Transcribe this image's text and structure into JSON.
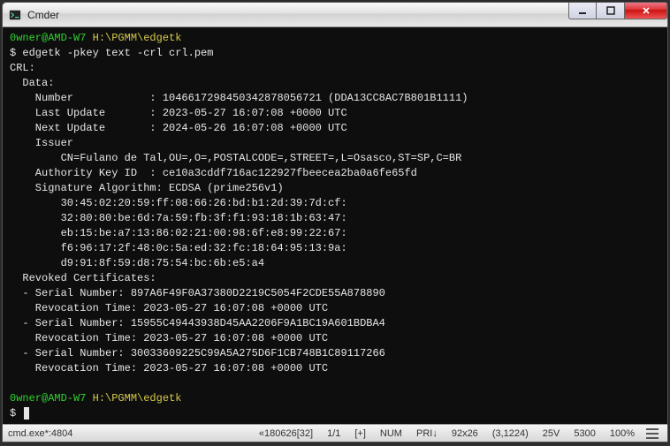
{
  "window": {
    "title": "Cmder"
  },
  "terminal": {
    "prompt": {
      "userhost": "0wner@AMD-W7",
      "path": "H:\\PGMM\\edgetk",
      "symbol": "$"
    },
    "command": "edgetk -pkey text -crl crl.pem",
    "output": [
      "CRL:",
      "  Data:",
      "    Number            : 10466172984503428780567 21 (DDA13CC8AC7B801B1111)",
      "    Last Update       : 2023-05-27 16:07:08 +0000 UTC",
      "    Next Update       : 2024-05-26 16:07:08 +0000 UTC",
      "    Issuer",
      "        CN=Fulano de Tal,OU=,O=,POSTALCODE=,STREET=,L=Osasco,ST=SP,C=BR",
      "    Authority Key ID  : ce10a3cddf716ac122927fbeecea2ba0a6fe65fd",
      "    Signature Algorithm: ECDSA (prime256v1)",
      "        30:45:02:20:59:ff:08:66:26:bd:b1:2d:39:7d:cf:",
      "        32:80:80:be:6d:7a:59:fb:3f:f1:93:18:1b:63:47:",
      "        eb:15:be:a7:13:86:02:21:00:98:6f:e8:99:22:67:",
      "        f6:96:17:2f:48:0c:5a:ed:32:fc:18:64:95:13:9a:",
      "        d9:91:8f:59:d8:75:54:bc:6b:e5:a4",
      "  Revoked Certificates:",
      "  - Serial Number: 897A6F49F0A37380D2219C5054F2CDE55A878890",
      "    Revocation Time: 2023-05-27 16:07:08 +0000 UTC",
      "  - Serial Number: 15955C49443938D45AA2206F9A1BC19A601BDBA4",
      "    Revocation Time: 2023-05-27 16:07:08 +0000 UTC",
      "  - Serial Number: 30033609225C99A5A275D6F1CB748B1C89117266",
      "    Revocation Time: 2023-05-27 16:07:08 +0000 UTC",
      ""
    ]
  },
  "statusbar": {
    "session": "cmd.exe*:4804",
    "coords": "«180626[32]",
    "pos": "1/1",
    "caps": "[+]",
    "num": "NUM",
    "pri": "PRI↓",
    "size": "92x26",
    "cursor": "(3,1224)",
    "vt": "25V",
    "mem": "5300",
    "pct": "100%"
  }
}
